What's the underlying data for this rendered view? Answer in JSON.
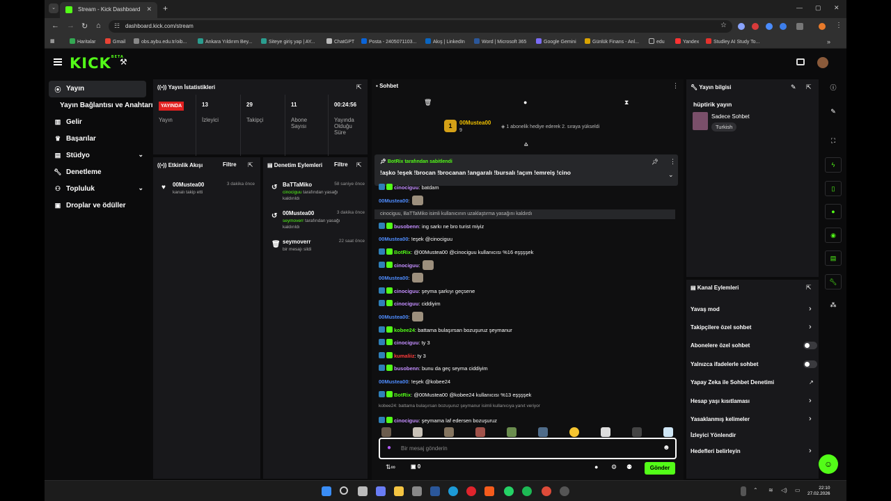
{
  "browser": {
    "tab_title": "Stream - Kick Dashboard",
    "url": "dashboard.kick.com/stream",
    "bookmarks": [
      "Haritalar",
      "Gmail",
      "obs.aybu.edu.tr/oib...",
      "Ankara Yıldırım Bey...",
      "Siteye giriş yap | AY...",
      "ChatGPT",
      "Posta - 2405071103...",
      "Akış | LinkedIn",
      "Word | Microsoft 365",
      "Google Gemini",
      "Günlük Finans - Anl...",
      "edu",
      "Yandex",
      "Studley AI Study To..."
    ]
  },
  "header": {
    "logo": "KICK",
    "logo_sup": "BETA"
  },
  "sidebar": {
    "items": [
      {
        "label": "Yayın",
        "icon": "broadcast-icon"
      },
      {
        "label": "Yayın Bağlantısı ve Anahtarı",
        "icon": ""
      },
      {
        "label": "Gelir",
        "icon": "chart-icon"
      },
      {
        "label": "Başarılar",
        "icon": "trophy-icon"
      },
      {
        "label": "Stüdyo",
        "icon": "studio-icon"
      },
      {
        "label": "Denetleme",
        "icon": "wrench-icon"
      },
      {
        "label": "Topluluk",
        "icon": "people-icon"
      },
      {
        "label": "Droplar ve ödüller",
        "icon": "gift-icon"
      }
    ]
  },
  "stats": {
    "title": "Yayın İstatistikleri",
    "live_badge": "YAYINDA",
    "live_label": "Yayın",
    "viewers_value": "13",
    "viewers_label": "İzleyici",
    "followers_value": "29",
    "followers_label": "Takipçi",
    "subs_value": "11",
    "subs_label1": "Abone",
    "subs_label2": "Sayısı",
    "duration_value": "00:24:56",
    "duration_label1": "Yayında",
    "duration_label2": "Olduğu",
    "duration_label3": "Süre"
  },
  "activity": {
    "title": "Etkinlik Akışı",
    "filter": "Filtre",
    "events": [
      {
        "name": "00Mustea00",
        "desc": "kanalı takip etti",
        "time": "3 dakika önce"
      }
    ]
  },
  "mod_actions": {
    "title": "Denetim Eylemleri",
    "filter": "Filtre",
    "items": [
      {
        "name": "BaTTaMiko",
        "time": "58 saniye önce",
        "target": "cinociguu",
        "desc": "tarafından yasağı",
        "desc2": "kaldırıldı"
      },
      {
        "name": "00Mustea00",
        "time": "3 dakika önce",
        "target": "seymoverr",
        "desc": "tarafından yasağı",
        "desc2": "kaldırıldı"
      },
      {
        "name": "seymoverr",
        "time": "22 saat önce",
        "desc2": "bir mesajı sildi"
      }
    ]
  },
  "chat": {
    "title": "Sohbet",
    "gift_user": "00Mustea00",
    "gift_count": "9",
    "gift_text": "1 abonelik hediye ederek 2. sıraya yükseldi",
    "pinned_by": "BotRix tarafından sabitlendi",
    "pinned_msg": "!aşko !eşek !brocan !brocanan !angaralı !bursalı !açım !emreiş !cino",
    "messages": [
      {
        "user": "cinociguu",
        "color": "#c48fff",
        "text": ": batdam"
      },
      {
        "user": "00Mustea00",
        "color": "#4f8dff",
        "text": ":"
      },
      {
        "system": "cinociguu, BaTTaMiko isimli kullanıcının uzaklaştırma yasağını kaldırdı"
      },
      {
        "user": "busobenn",
        "color": "#c48fff",
        "text": ": ing sarkı ne bro turist miyiz"
      },
      {
        "user": "00Mustea00",
        "color": "#4f8dff",
        "text": ": !eşek @cinociguu"
      },
      {
        "user": "BotRix",
        "color": "#53fc18",
        "text": ": @00Mustea00 @cinociguu kullanıcısı %16 eşşşşek"
      },
      {
        "user": "cinociguu",
        "color": "#c48fff",
        "text": ":"
      },
      {
        "user": "00Mustea00",
        "color": "#4f8dff",
        "text": ":"
      },
      {
        "user": "cinociguu",
        "color": "#c48fff",
        "text": ": şeyma şarkıyı geçsene"
      },
      {
        "user": "cinociguu",
        "color": "#c48fff",
        "text": ": ciddiyim"
      },
      {
        "user": "00Mustea00",
        "color": "#4f8dff",
        "text": ":"
      },
      {
        "user": "kobee24",
        "color": "#53fc18",
        "text": ": battama bulaşırsan bozuşuruz şeymanur"
      },
      {
        "user": "cinociguu",
        "color": "#c48fff",
        "text": ": ty 3"
      },
      {
        "user": "kumaliiz",
        "color": "#ff3b3b",
        "text": ": ty 3"
      },
      {
        "user": "busobenn",
        "color": "#c48fff",
        "text": ": bunu da geç seyma ciddiyim"
      },
      {
        "user": "00Mustea00",
        "color": "#4f8dff",
        "text": ": !eşek @kobee24"
      },
      {
        "user": "BotRix",
        "color": "#53fc18",
        "text": ": @00Mustea00 @kobee24 kullanıcısı %13 eşşşşek"
      },
      {
        "reply": "kobee24: battama bulaşırsan bozuşuruz şeymanur isimli kullanıcıya yanıt veriyor"
      },
      {
        "user": "cinociguu",
        "color": "#c48fff",
        "text": ": şeymama laf edersen bozuşuruz"
      }
    ],
    "input_placeholder": "Bir mesaj gönderin",
    "points": "0",
    "send_label": "Gönder"
  },
  "stream_info": {
    "title": "Yayın bilgisi",
    "stream_title": "hüptirik yayın",
    "category": "Sadece Sohbet",
    "language": "Turkish"
  },
  "channel_actions": {
    "title": "Kanal Eylemleri",
    "items": [
      {
        "label": "Yavaş mod",
        "kind": "arrow"
      },
      {
        "label": "Takipçilere özel sohbet",
        "kind": "arrow"
      },
      {
        "label": "Abonelere özel sohbet",
        "kind": "toggle"
      },
      {
        "label": "Yalnızca ifadelerle sohbet",
        "kind": "toggle"
      },
      {
        "label": "Yapay Zeka ile Sohbet Denetimi",
        "kind": "link"
      },
      {
        "label": "Hesap yaşı kısıtlaması",
        "kind": "arrow"
      },
      {
        "label": "Yasaklanmış kelimeler",
        "kind": "arrow"
      },
      {
        "label": "İzleyici Yönlendir",
        "kind": "none"
      },
      {
        "label": "Hedefleri belirleyin",
        "kind": "arrow"
      }
    ]
  },
  "taskbar": {
    "time": "22:10",
    "date": "27.02.2026"
  },
  "colors": {
    "accent": "#53fc18",
    "panel": "#18181b",
    "live": "#e22121"
  }
}
